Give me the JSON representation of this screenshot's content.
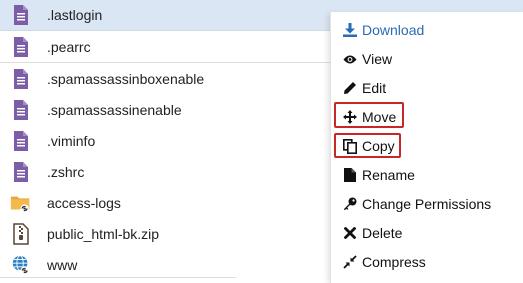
{
  "files": [
    {
      "name": ".lastlogin",
      "type": "text",
      "selected": true
    },
    {
      "name": ".pearrc",
      "type": "text",
      "selected": false
    },
    {
      "name": ".spamassassinboxenable",
      "type": "text",
      "selected": false
    },
    {
      "name": ".spamassassinenable",
      "type": "text",
      "selected": false
    },
    {
      "name": ".viminfo",
      "type": "text",
      "selected": false
    },
    {
      "name": ".zshrc",
      "type": "text",
      "selected": false
    },
    {
      "name": "access-logs",
      "type": "folder-link",
      "selected": false
    },
    {
      "name": "public_html-bk.zip",
      "type": "zip",
      "selected": false
    },
    {
      "name": "www",
      "type": "web-link",
      "selected": false
    }
  ],
  "context_menu": {
    "items": [
      {
        "label": "Download",
        "icon": "download-icon"
      },
      {
        "label": "View",
        "icon": "eye-icon"
      },
      {
        "label": "Edit",
        "icon": "pencil-icon"
      },
      {
        "label": "Move",
        "icon": "move-arrows-icon"
      },
      {
        "label": "Copy",
        "icon": "copy-icon"
      },
      {
        "label": "Rename",
        "icon": "file-icon"
      },
      {
        "label": "Change Permissions",
        "icon": "key-icon"
      },
      {
        "label": "Delete",
        "icon": "x-icon"
      },
      {
        "label": "Compress",
        "icon": "compress-icon"
      }
    ],
    "highlighted": [
      "Move",
      "Copy"
    ]
  },
  "colors": {
    "selected_row": "#dbe6f4",
    "text_file_icon": "#7b5ea7",
    "folder_icon": "#e9a63a",
    "menu_primary": "#2a6bb5",
    "highlight_border": "#c62828"
  }
}
